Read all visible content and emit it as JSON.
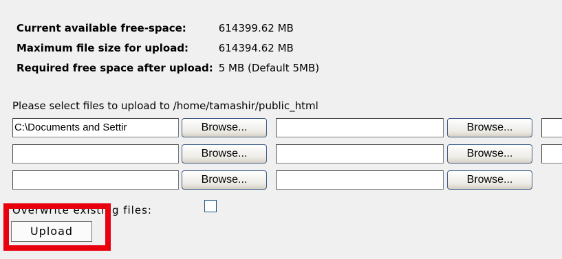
{
  "info": {
    "free_space_label": "Current available free-space:",
    "free_space_value": "614399.62 MB",
    "max_size_label": "Maximum file size for upload:",
    "max_size_value": "614394.62 MB",
    "required_label": "Required free space after upload:",
    "required_value": "5 MB (Default 5MB)"
  },
  "select_title": "Please select files to upload to /home/tamashir/public_html",
  "files": {
    "row1_col1_value": "C:\\Documents and Settir",
    "browse_label": "Browse..."
  },
  "overwrite_label": "Overwrite existing files:",
  "overwrite_checked": false,
  "upload_label": "Upload",
  "colors": {
    "highlight": "#e8000f",
    "background": "#f0f0f0",
    "button_border": "#3c5a86"
  }
}
